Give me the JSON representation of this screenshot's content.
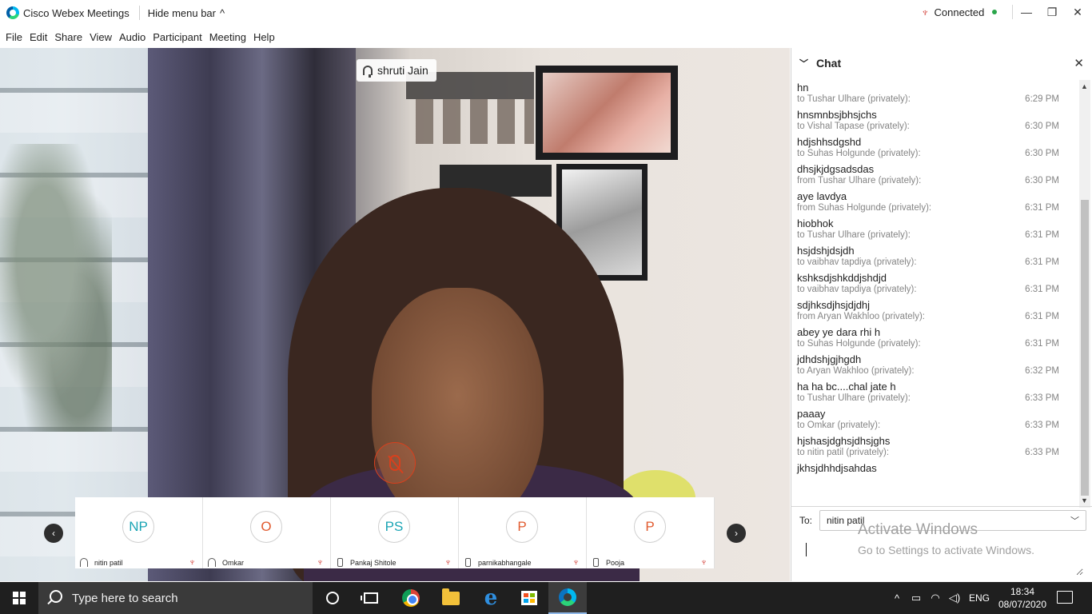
{
  "window": {
    "app_title": "Cisco Webex Meetings",
    "hide_menu_label": "Hide menu bar",
    "hide_menu_chevron": "^",
    "status": "Connected",
    "status_color": "#2aa54a",
    "controls": {
      "minimize": "—",
      "restore": "❐",
      "close": "✕"
    }
  },
  "menu": [
    "File",
    "Edit",
    "Share",
    "View",
    "Audio",
    "Participant",
    "Meeting",
    "Help"
  ],
  "video": {
    "active_speaker": "shruti Jain",
    "mute_ring_icon": "mic-muted-icon",
    "nav_prev": "‹",
    "nav_next": "›"
  },
  "participants": [
    {
      "initials": "NP",
      "name": "nitin patil",
      "audio": "headset-icon",
      "avatar_color": "#1ba5b5",
      "muted": true
    },
    {
      "initials": "O",
      "name": "Omkar",
      "audio": "headset-icon",
      "avatar_color": "#e15a2e",
      "muted": true
    },
    {
      "initials": "PS",
      "name": "Pankaj Shitole",
      "audio": "phone-icon",
      "avatar_color": "#1ba5b5",
      "muted": true
    },
    {
      "initials": "P",
      "name": "parnikabhangale",
      "audio": "phone-icon",
      "avatar_color": "#e15a2e",
      "muted": true
    },
    {
      "initials": "P",
      "name": "Pooja",
      "audio": "phone-icon",
      "avatar_color": "#e15a2e",
      "muted": true
    }
  ],
  "chat": {
    "title": "Chat",
    "first_line": "hn",
    "messages": [
      {
        "meta": "to Tushar Ulhare (privately):",
        "time": "6:29 PM",
        "text": "hnsmnbsjbhsjchs"
      },
      {
        "meta": "to Vishal Tapase (privately):",
        "time": "6:30 PM",
        "text": "hdjshhsdgshd"
      },
      {
        "meta": "to Suhas Holgunde (privately):",
        "time": "6:30 PM",
        "text": "dhsjkjdgsadsdas"
      },
      {
        "meta": "from Tushar Ulhare (privately):",
        "time": "6:30 PM",
        "text": "aye lavdya"
      },
      {
        "meta": "from Suhas Holgunde (privately):",
        "time": "6:31 PM",
        "text": "hiobhok"
      },
      {
        "meta": "to Tushar Ulhare (privately):",
        "time": "6:31 PM",
        "text": "hsjdshjdsjdh"
      },
      {
        "meta": "to vaibhav tapdiya (privately):",
        "time": "6:31 PM",
        "text": "kshksdjshkddjshdjd"
      },
      {
        "meta": "to vaibhav tapdiya (privately):",
        "time": "6:31 PM",
        "text": "sdjhksdjhsjdjdhj"
      },
      {
        "meta": "from Aryan Wakhloo (privately):",
        "time": "6:31 PM",
        "text": "abey ye dara rhi h"
      },
      {
        "meta": "to Suhas Holgunde (privately):",
        "time": "6:31 PM",
        "text": "jdhdshjgjhgdh"
      },
      {
        "meta": "to Aryan Wakhloo (privately):",
        "time": "6:32 PM",
        "text": "ha ha bc....chal jate h"
      },
      {
        "meta": "to Tushar Ulhare (privately):",
        "time": "6:33 PM",
        "text": "paaay"
      },
      {
        "meta": "to Omkar (privately):",
        "time": "6:33 PM",
        "text": "hjshasjdghsjdhsjghs"
      },
      {
        "meta": "to nitin patil (privately):",
        "time": "6:33 PM",
        "text": "jkhsjdhhdjsahdas"
      }
    ],
    "to_label": "To:",
    "to_value": "nitin patil",
    "input_value": ""
  },
  "watermark": {
    "line1": "Activate Windows",
    "line2": "Go to Settings to activate Windows."
  },
  "taskbar": {
    "search_placeholder": "Type here to search",
    "language": "ENG",
    "time": "18:34",
    "date": "08/07/2020"
  }
}
